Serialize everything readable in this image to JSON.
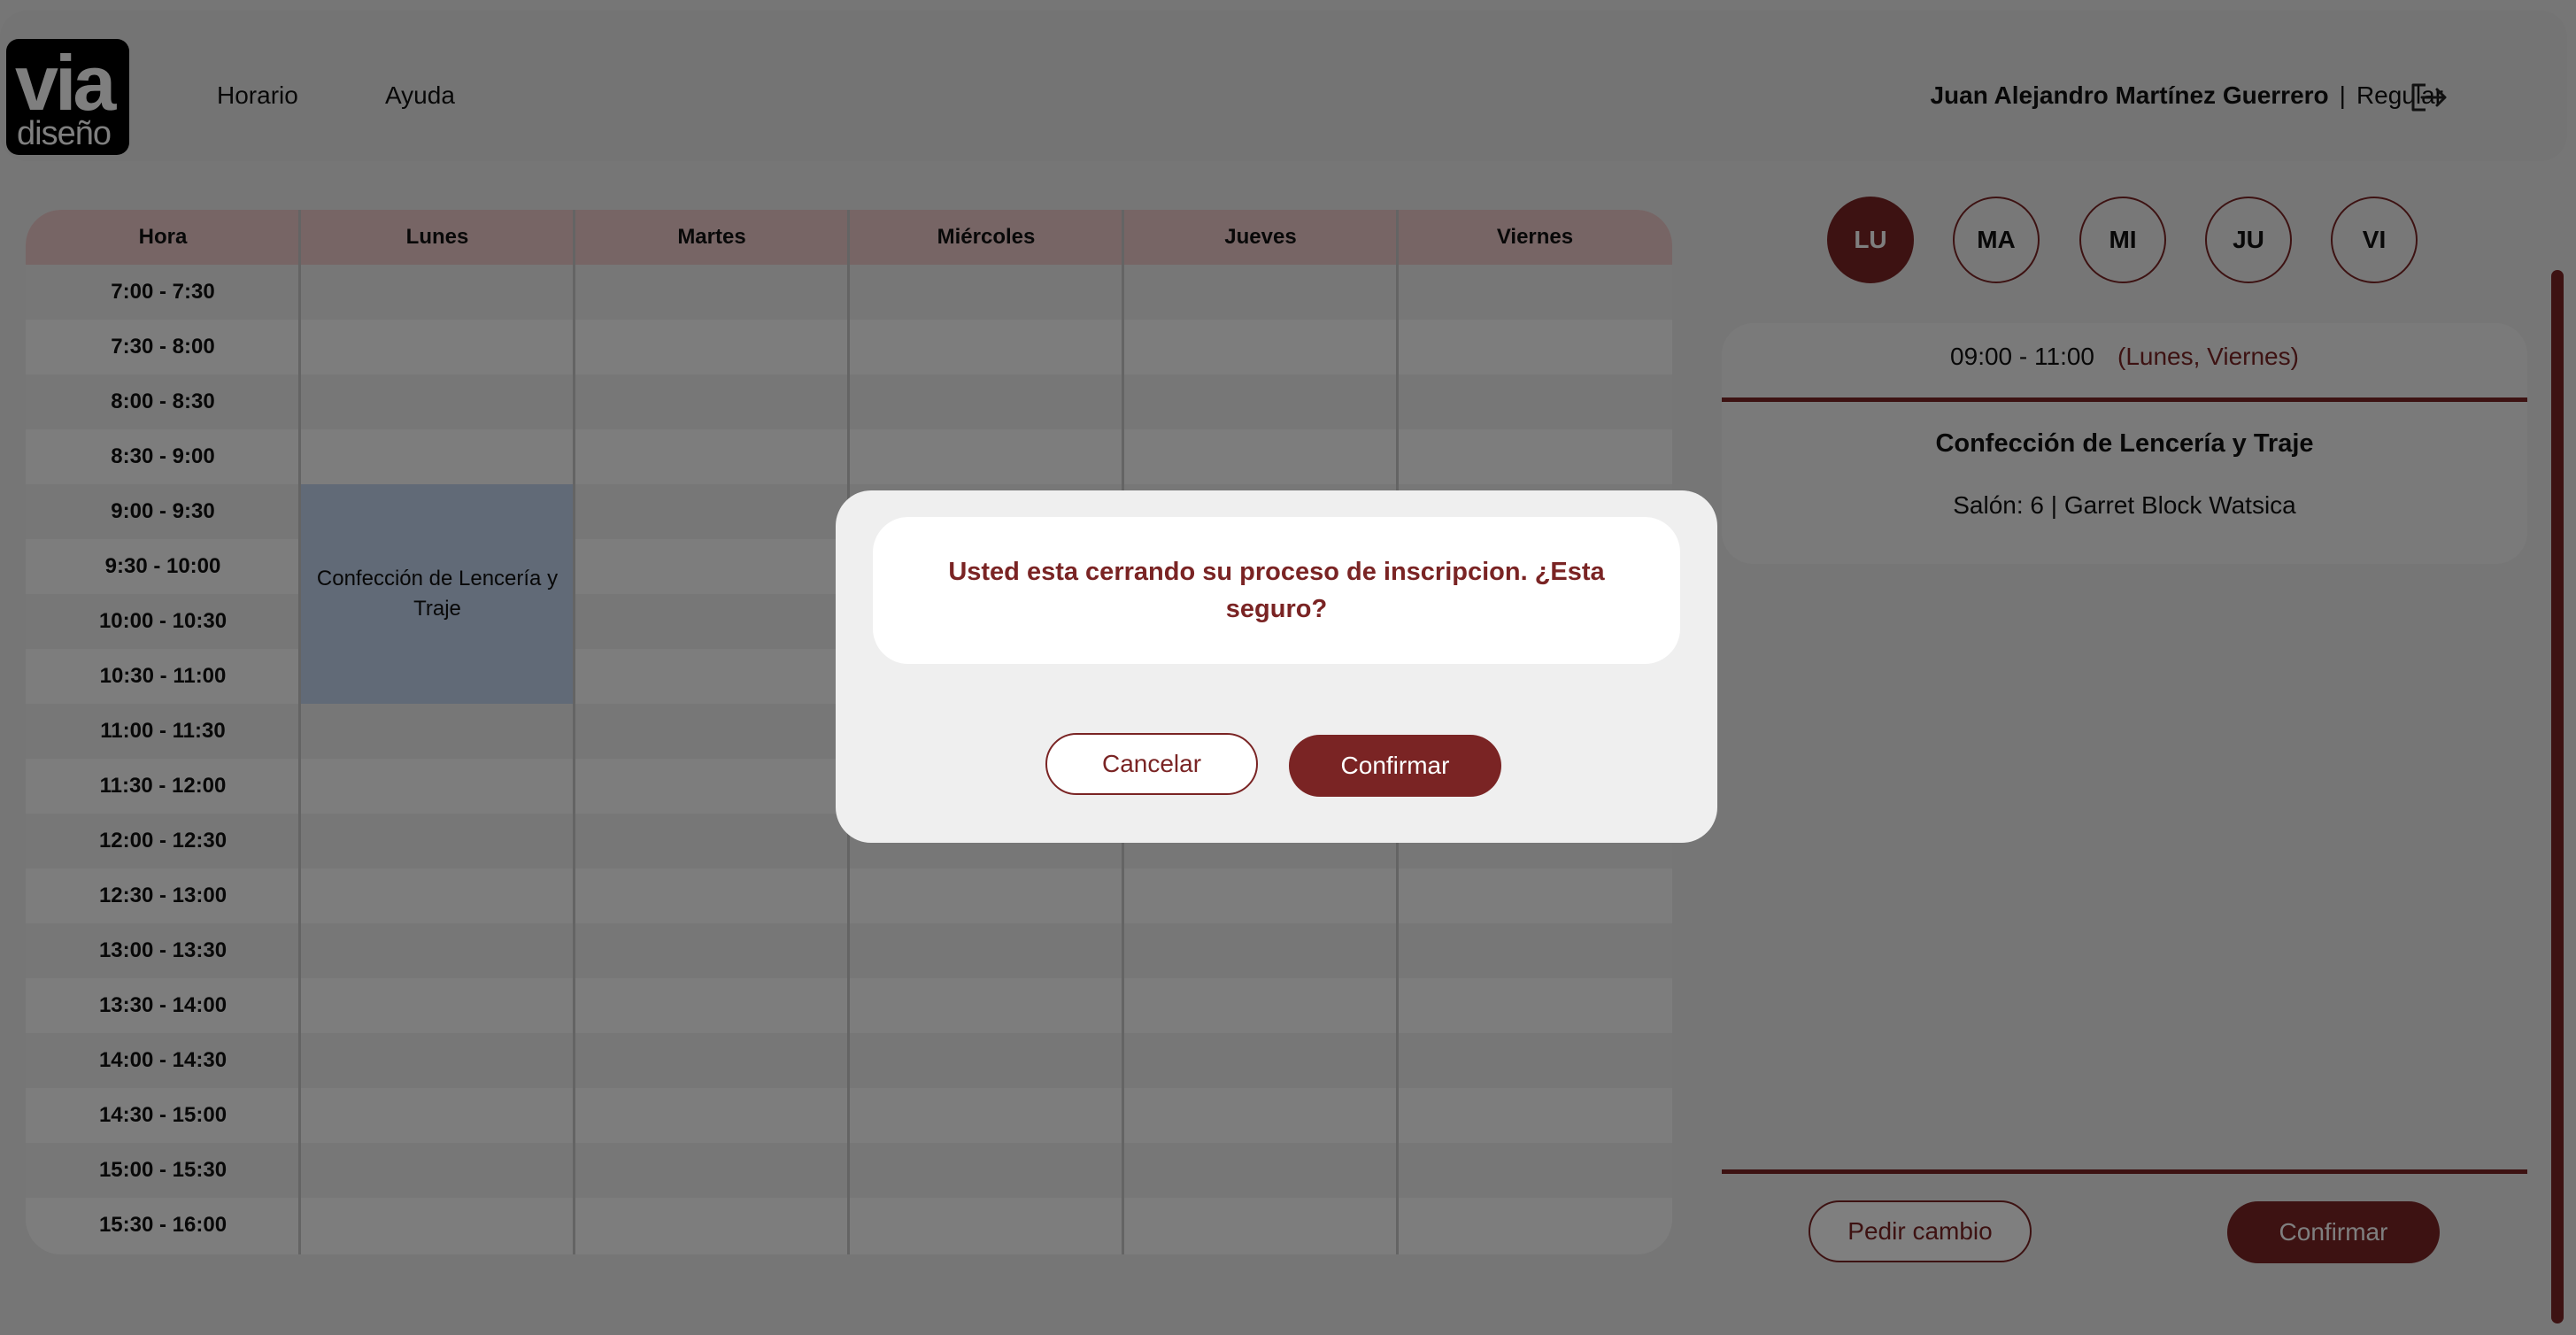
{
  "header": {
    "logo": {
      "line1": "via",
      "line2": "diseño"
    },
    "nav": [
      "Horario",
      "Ayuda"
    ],
    "user_name": "Juan Alejandro Martínez Guerrero",
    "separator": "|",
    "user_type": "Regular",
    "logout_icon": "logout-icon"
  },
  "schedule": {
    "columns": [
      "Hora",
      "Lunes",
      "Martes",
      "Miércoles",
      "Jueves",
      "Viernes"
    ],
    "times": [
      "7:00 - 7:30",
      "7:30 - 8:00",
      "8:00 - 8:30",
      "8:30 - 9:00",
      "9:00 - 9:30",
      "9:30 - 10:00",
      "10:00 - 10:30",
      "10:30 - 11:00",
      "11:00 - 11:30",
      "11:30 - 12:00",
      "12:00 - 12:30",
      "12:30 - 13:00",
      "13:00 - 13:30",
      "13:30 - 14:00",
      "14:00 - 14:30",
      "14:30 - 15:00",
      "15:00 - 15:30",
      "15:30 - 16:00"
    ],
    "course_block": {
      "label": "Confección de Lencería y Traje"
    }
  },
  "panel": {
    "days": [
      "LU",
      "MA",
      "MI",
      "JU",
      "VI"
    ],
    "active_day": "LU",
    "time": "09:00 - 11:00",
    "days_text": "(Lunes, Viernes)",
    "course_name": "Confección de Lencería y Traje",
    "room": "Salón: 6 | Garret Block Watsica",
    "request_change": "Pedir cambio",
    "confirm": "Confirmar"
  },
  "modal": {
    "message": "Usted esta cerrando su proceso de inscripcion. ¿Esta seguro?",
    "cancel": "Cancelar",
    "confirm": "Confirmar"
  },
  "colors": {
    "accent": "#7a2424",
    "header_row": "#efcaca",
    "course_block": "#c2d4ef"
  }
}
